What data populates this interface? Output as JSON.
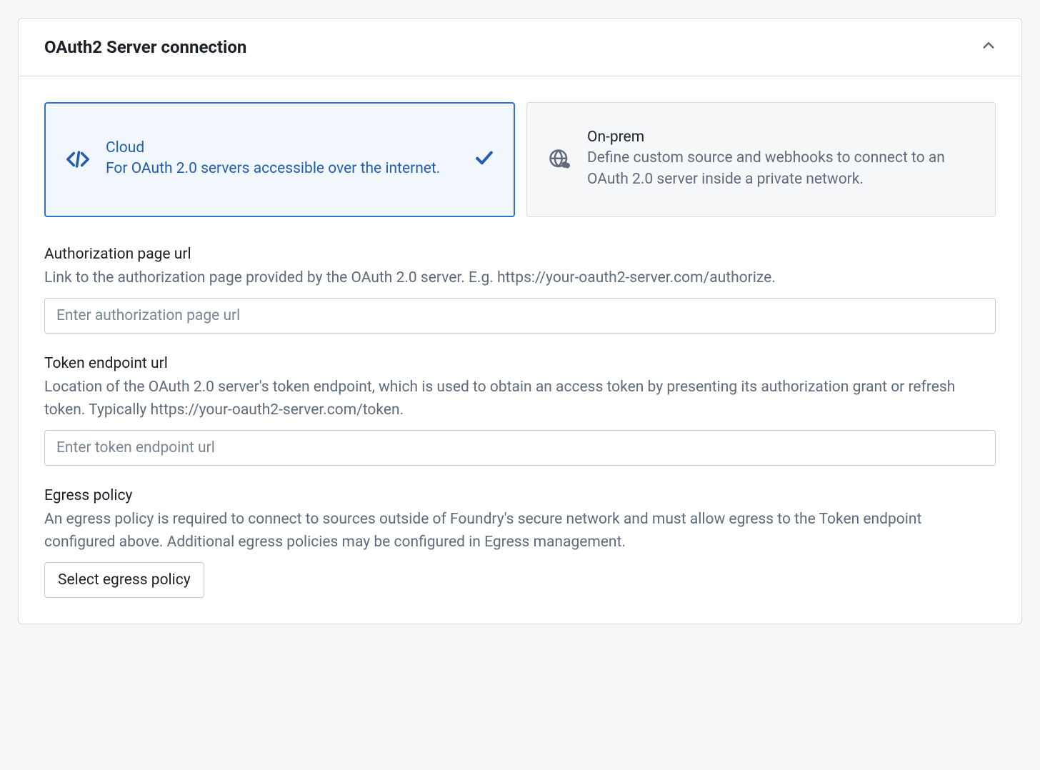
{
  "panel": {
    "title": "OAuth2 Server connection"
  },
  "options": {
    "cloud": {
      "title": "Cloud",
      "desc": "For OAuth 2.0 servers accessible over the internet."
    },
    "onprem": {
      "title": "On-prem",
      "desc": "Define custom source and webhooks to connect to an OAuth 2.0 server inside a private network."
    }
  },
  "fields": {
    "authUrl": {
      "label": "Authorization page url",
      "help": "Link to the authorization page provided by the OAuth 2.0 server. E.g. https://your-oauth2-server.com/authorize.",
      "placeholder": "Enter authorization page url",
      "value": ""
    },
    "tokenUrl": {
      "label": "Token endpoint url",
      "help": "Location of the OAuth 2.0 server's token endpoint, which is used to obtain an access token by presenting its authorization grant or refresh token. Typically https://your-oauth2-server.com/token.",
      "placeholder": "Enter token endpoint url",
      "value": ""
    },
    "egress": {
      "label": "Egress policy",
      "help": "An egress policy is required to connect to sources outside of Foundry's secure network and must allow egress to the Token endpoint configured above. Additional egress policies may be configured in Egress management.",
      "button": "Select egress policy"
    }
  }
}
